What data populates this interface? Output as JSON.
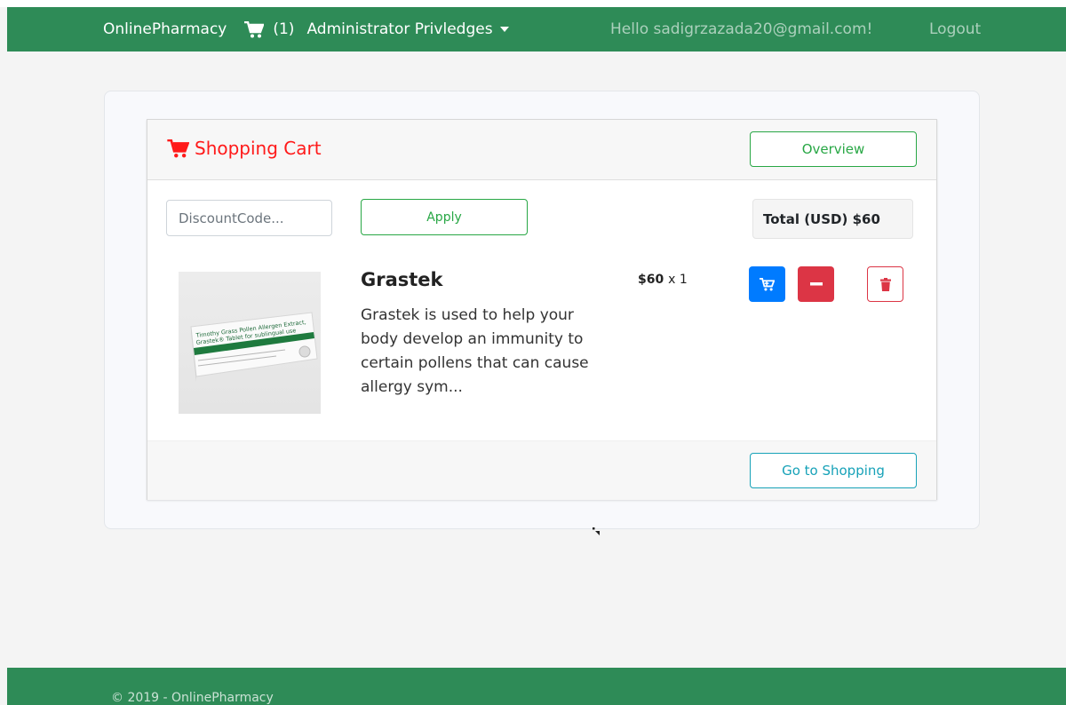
{
  "navbar": {
    "brand": "OnlinePharmacy",
    "cart_count": "(1)",
    "admin_menu": "Administrator Privledges",
    "greeting": "Hello sadigrzazada20@gmail.com!",
    "logout": "Logout",
    "color": "#2e8b57"
  },
  "cart": {
    "title": "Shopping Cart",
    "overview_label": "Overview",
    "discount_placeholder": "DiscountCode...",
    "apply_label": "Apply",
    "total": "Total (USD) $60",
    "go_shopping_label": "Go to Shopping",
    "title_color": "#ff1a1a"
  },
  "item": {
    "name": "Grastek",
    "description": "Grastek is used to help your body develop an immunity to certain pollens that can cause allergy sym...",
    "price": "$60",
    "quantity_text": "x 1",
    "package_lines": [
      "Timothy Grass Pollen Allergen Extract,",
      "Grastek® Tablet for sublingual use"
    ],
    "icons": [
      "cart-plus-icon",
      "minus-icon",
      "trash-icon"
    ]
  },
  "footer": {
    "copyright": "© 2019 - OnlinePharmacy"
  }
}
